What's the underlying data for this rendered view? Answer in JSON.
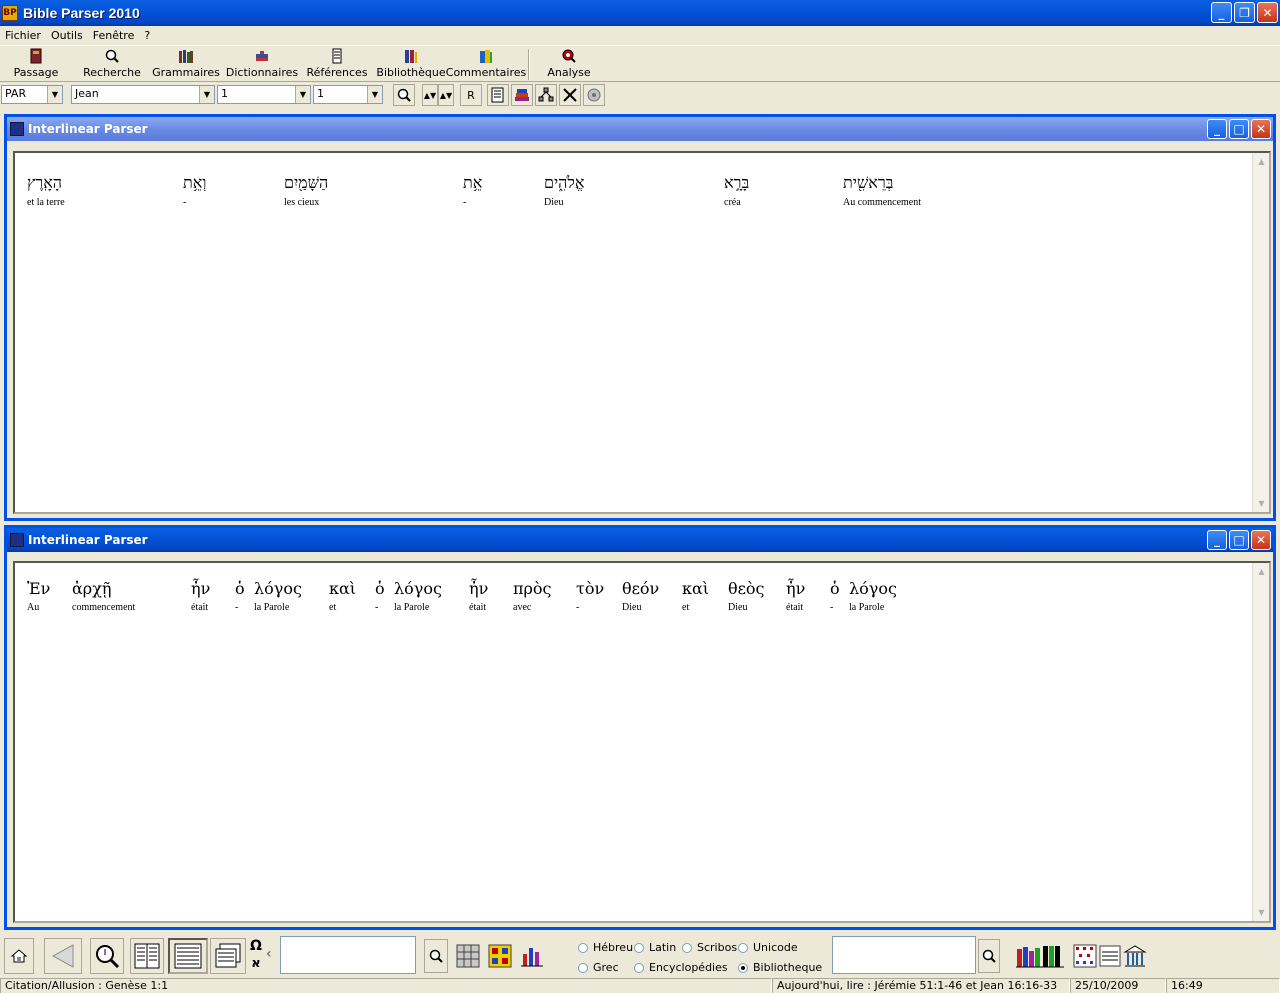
{
  "window": {
    "title": "Bible Parser 2010",
    "app_icon_text": "BP"
  },
  "menu": [
    "Fichier",
    "Outils",
    "Fenêtre",
    "?"
  ],
  "toolbar": {
    "buttons": [
      "Passage",
      "Recherche",
      "Grammaires",
      "Dictionnaires",
      "Références",
      "Bibliothèque",
      "Commentaires",
      "Analyse"
    ]
  },
  "selectors": {
    "version": "PAR",
    "book": "Jean",
    "chapter": "1",
    "verse": "1",
    "r_button": "R"
  },
  "panes": [
    {
      "title": "Interlinear Parser",
      "words": [
        {
          "src": "הָאָֽרֶץ",
          "gloss": "et la terre"
        },
        {
          "src": "וְאֵ֥ת",
          "gloss": "-"
        },
        {
          "src": "הַשָּׁמַ֖יִם",
          "gloss": "les cieux"
        },
        {
          "src": "אֵ֥ת",
          "gloss": "-"
        },
        {
          "src": "אֱלֹהִ֑ים",
          "gloss": "Dieu"
        },
        {
          "src": "בָּרָ֣א",
          "gloss": "créa"
        },
        {
          "src": "בְּרֵאשִׁ֖ית",
          "gloss": "Au commencement"
        }
      ]
    },
    {
      "title": "Interlinear Parser",
      "words": [
        {
          "src": "Ἐν",
          "gloss": "Au"
        },
        {
          "src": "ἀρχῇ",
          "gloss": "commencement"
        },
        {
          "src": "ἦν",
          "gloss": "était"
        },
        {
          "src": "ὁ",
          "gloss": "-"
        },
        {
          "src": "λόγος",
          "gloss": "la Parole"
        },
        {
          "src": "καὶ",
          "gloss": "et"
        },
        {
          "src": "ὁ",
          "gloss": "-"
        },
        {
          "src": "λόγος",
          "gloss": "la Parole"
        },
        {
          "src": "ἦν",
          "gloss": "était"
        },
        {
          "src": "πρὸς",
          "gloss": "avec"
        },
        {
          "src": "τὸν",
          "gloss": "-"
        },
        {
          "src": "θεόν",
          "gloss": "Dieu"
        },
        {
          "src": "καὶ",
          "gloss": "et"
        },
        {
          "src": "θεὸς",
          "gloss": "Dieu"
        },
        {
          "src": "ἦν",
          "gloss": "était"
        },
        {
          "src": "ὁ",
          "gloss": "-"
        },
        {
          "src": "λόγος",
          "gloss": "la Parole"
        }
      ]
    }
  ],
  "bottom": {
    "omega": "Ω",
    "aleph": "א",
    "chevron": "‹",
    "radios": [
      "Hébreu",
      "Latin",
      "Scribos",
      "Unicode",
      "Grec",
      "Encyclopédies",
      "Bibliotheque"
    ],
    "selected_radio": "Bibliotheque"
  },
  "status": {
    "citation": "Citation/Allusion : Genèse 1:1",
    "reading": "Aujourd'hui, lire : Jérémie 51:1-46 et Jean 16:16-33",
    "date": "25/10/2009",
    "time": "16:49"
  }
}
